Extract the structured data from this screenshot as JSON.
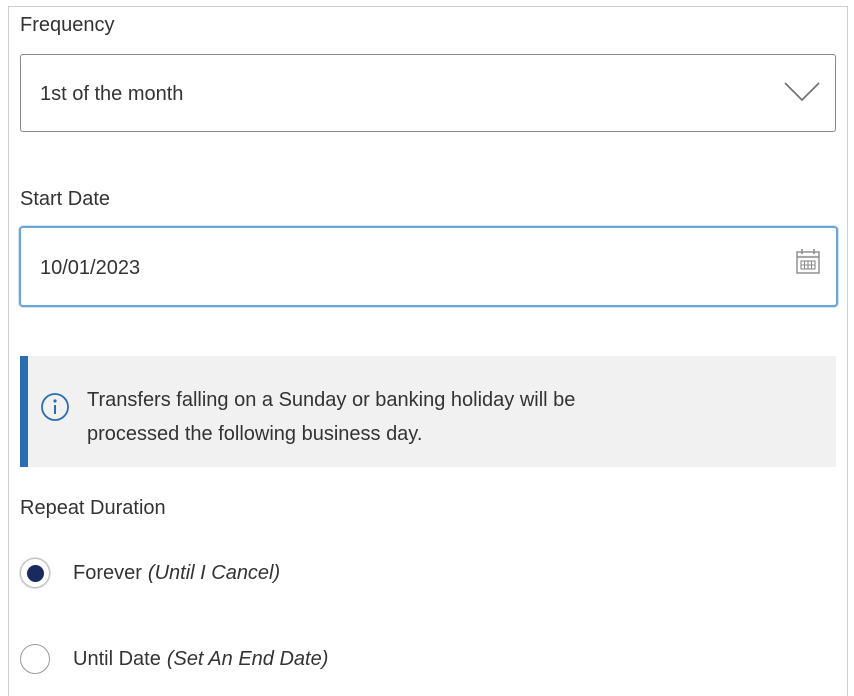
{
  "frequency": {
    "label": "Frequency",
    "selected_value": "1st of the month",
    "icon": "chevron-down-icon"
  },
  "start_date": {
    "label": "Start Date",
    "value": "10/01/2023",
    "icon": "calendar-icon"
  },
  "info": {
    "icon": "info-icon",
    "line1": "Transfers falling on a Sunday or banking holiday will be",
    "line2": "processed the following business day.",
    "accent_color": "#2a6db5"
  },
  "repeat_duration": {
    "label": "Repeat Duration",
    "options": [
      {
        "label": "Forever",
        "hint": "(Until I Cancel)",
        "selected": true
      },
      {
        "label": "Until Date",
        "hint": "(Set An End Date)",
        "selected": false
      }
    ],
    "selected_color": "#1a2a5e"
  }
}
